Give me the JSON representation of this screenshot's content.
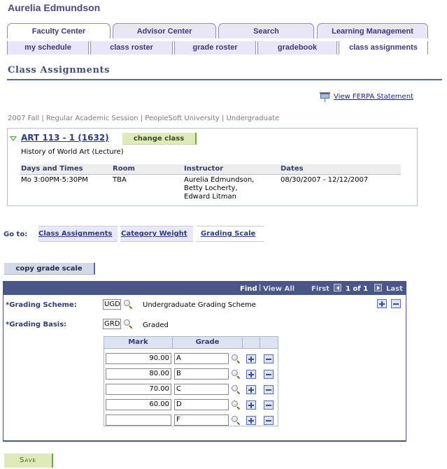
{
  "user_name": "Aurelia Edmundson",
  "tabs": [
    {
      "label": "Faculty Center",
      "active": true
    },
    {
      "label": "Advisor Center",
      "active": false
    },
    {
      "label": "Search",
      "active": false
    },
    {
      "label": "Learning Management",
      "active": false
    }
  ],
  "subtabs": [
    {
      "label": "my schedule",
      "active": false
    },
    {
      "label": "class roster",
      "active": false
    },
    {
      "label": "grade roster",
      "active": false
    },
    {
      "label": "gradebook",
      "active": false
    },
    {
      "label": "class assignments",
      "active": true
    }
  ],
  "page_title": "Class Assignments",
  "ferpa_link": "View FERPA Statement",
  "term_line": "2007 Fall | Regular Academic Session | PeopleSoft University | Undergraduate",
  "class_info": {
    "class_link": "ART 113 - 1 (1632)",
    "change_class_label": "change class",
    "description": "History of World Art (Lecture)",
    "headers": {
      "days_times": "Days and Times",
      "room": "Room",
      "instructor": "Instructor",
      "dates": "Dates"
    },
    "row": {
      "days_times": "Mo 3:00PM-5:30PM",
      "room": "TBA",
      "instructors": [
        "Aurelia Edmundson,",
        "Betty Locherty,",
        "Edward Litman"
      ],
      "dates": "08/30/2007 - 12/12/2007"
    }
  },
  "goto": {
    "label": "Go to:",
    "links": [
      {
        "label": "Class Assignments",
        "active": false
      },
      {
        "label": "Category Weight",
        "active": false
      },
      {
        "label": "Grading Scale",
        "active": true
      }
    ]
  },
  "copy_grade_scale_label": "copy grade scale",
  "scroll_nav": {
    "find": "Find",
    "view_all": "View All",
    "first": "First",
    "counter": "1 of 1",
    "last": "Last"
  },
  "grading_scheme": {
    "label": "*Grading Scheme:",
    "code": "UGD",
    "description": "Undergraduate Grading Scheme"
  },
  "grading_basis": {
    "label": "*Grading Basis:",
    "code": "GRD",
    "description": "Graded"
  },
  "grade_grid": {
    "headers": {
      "mark": "Mark",
      "grade": "Grade"
    },
    "rows": [
      {
        "mark": "90.00",
        "grade": "A"
      },
      {
        "mark": "80.00",
        "grade": "B"
      },
      {
        "mark": "70.00",
        "grade": "C"
      },
      {
        "mark": "60.00",
        "grade": "D"
      },
      {
        "mark": "",
        "grade": "F"
      }
    ]
  },
  "save_label": "Save"
}
